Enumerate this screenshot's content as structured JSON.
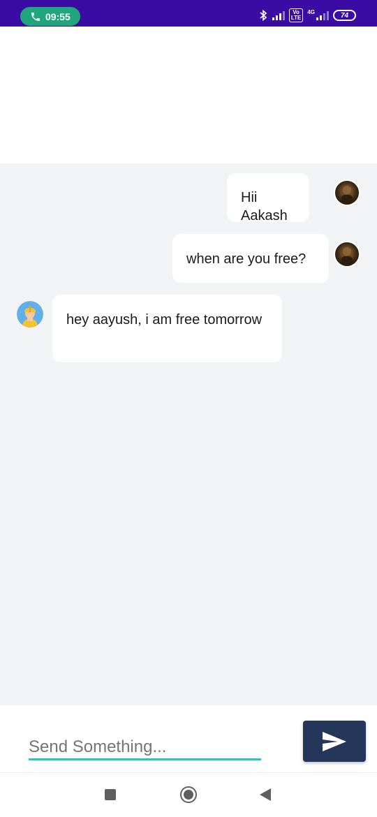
{
  "status_bar": {
    "time": "09:55",
    "volte": "Vo\nLTE",
    "network": "4G",
    "battery": "74",
    "colors": {
      "background": "#3a0ca3",
      "call_pill": "#1fa67a"
    },
    "icons": [
      "phone-icon",
      "bluetooth-icon",
      "signal-icon",
      "volte-icon",
      "signal-4g-icon",
      "battery-icon"
    ]
  },
  "messages": [
    {
      "sender": "me",
      "text": "Hii Aakash"
    },
    {
      "sender": "me",
      "text": "when are you free?"
    },
    {
      "sender": "other",
      "text": "hey aayush, i am free tomorrow"
    }
  ],
  "composer": {
    "placeholder": "Send Something...",
    "send_icon": "send-icon",
    "colors": {
      "underline": "#26c6c6",
      "send_button": "#24375a"
    }
  },
  "nav_bar": {
    "icons": [
      "recents-icon",
      "home-icon",
      "back-icon"
    ]
  },
  "colors": {
    "chat_background": "#f2f3f5",
    "bubble": "#ffffff"
  }
}
